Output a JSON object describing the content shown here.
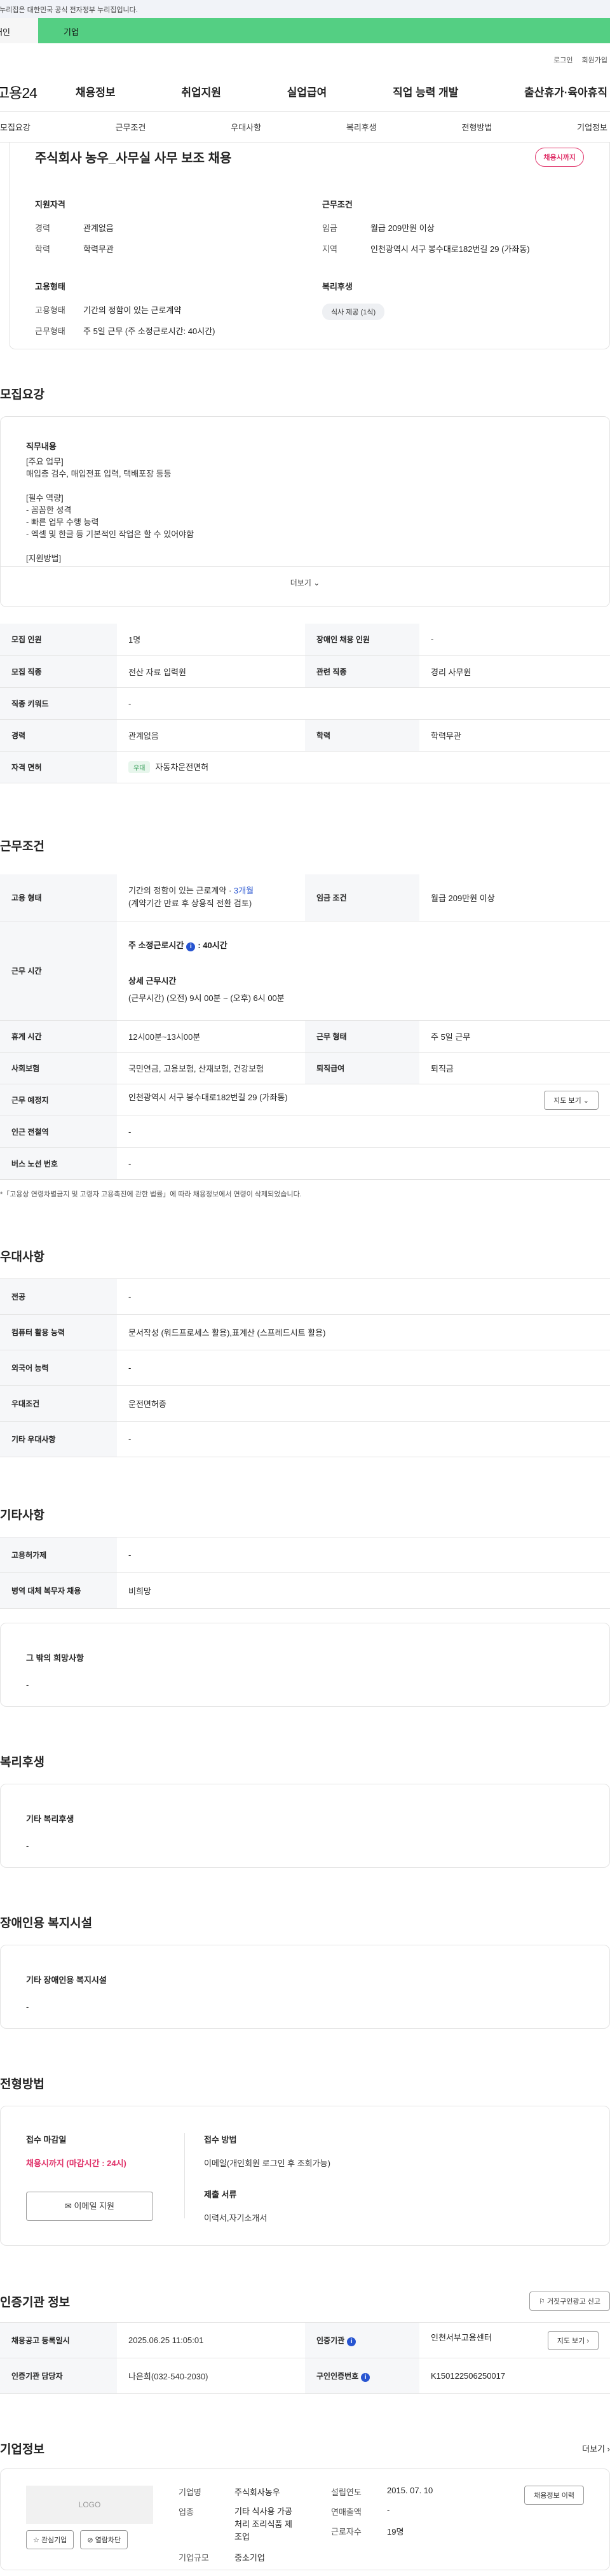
{
  "banner": "이 누리집은 대한민국 공식 전자정부 누리집입니다.",
  "top_tabs": [
    "개인",
    "기업"
  ],
  "util_links": [
    "로그인",
    "회원가입"
  ],
  "logo": "고용24",
  "gnb": [
    "채용정보",
    "취업지원",
    "실업급여",
    "직업 능력 개발",
    "출산휴가·육아휴직"
  ],
  "subnav": [
    "모집요강",
    "근무조건",
    "우대사항",
    "복리후생",
    "전형방법",
    "기업정보"
  ],
  "summary": {
    "title": "주식회사 농우_사무실 사무 보조 채용",
    "badge": "채용시까지",
    "qual_h": "지원자격",
    "career_k": "경력",
    "career_v": "관계없음",
    "edu_k": "학력",
    "edu_v": "학력무관",
    "cond_h": "근무조건",
    "wage_k": "임금",
    "wage_v": "월급 209만원 이상",
    "region_k": "지역",
    "region_v": "인천광역시 서구 봉수대로182번길 29 (가좌동)",
    "emp_h": "고용형태",
    "emptype_k": "고용형태",
    "emptype_v": "기간의 정함이 있는 근로계약",
    "worktype_k": "근무형태",
    "worktype_v": "주 5일 근무 (주 소정근로시간: 40시간)",
    "welfare_h": "복리후생",
    "welfare_chip": "식사 제공 (1식)"
  },
  "recruit": {
    "title": "모집요강",
    "desc_label": "직무내용",
    "desc_lines": [
      "[주요 업무]",
      "매입총 검수, 매입전표 입력, 택배포장 등등",
      "",
      "[필수 역량]",
      "- 꼼꼼한 성격",
      "- 빠른 업무 수행 능력",
      "- 엑셀 및 한글 등 기본적인 작업은 할 수 있어야함",
      "",
      "[지원방법]"
    ],
    "more": "더보기",
    "rows": [
      {
        "k1": "모집 인원",
        "v1": "1명",
        "k2": "장애인 채용 인원",
        "v2": "-"
      },
      {
        "k1": "모집 직종",
        "v1": "전산 자료 입력원",
        "k2": "관련 직종",
        "v2": "경리 사무원"
      },
      {
        "k1": "직종 키워드",
        "v1": "-"
      },
      {
        "k1": "경력",
        "v1": "관계없음",
        "k2": "학력",
        "v2": "학력무관"
      },
      {
        "k1": "자격 면허",
        "chip": "우대",
        "v1": "자동차운전면허"
      }
    ]
  },
  "work": {
    "title": "근무조건",
    "emp_k": "고용 형태",
    "emp_v1": "기간의 정함이 있는 근로계약 · ",
    "emp_v1b": "3개월",
    "emp_v2": "(계약기간 만료 후 상용직 전환 검토)",
    "wage_k": "임금 조건",
    "wage_v": "월급 209만원 이상",
    "hours_k": "근무 시간",
    "hours_l1": "주 소정근로시간",
    "hours_l1v": ": 40시간",
    "hours_l2": "상세 근무시간",
    "hours_l3": "(근무시간) (오전) 9시 00분 ~ (오후) 6시 00분",
    "break_k": "휴게 시간",
    "break_v": "12시00분~13시00분",
    "shift_k": "근무 형태",
    "shift_v": "주 5일 근무",
    "ins_k": "사회보험",
    "ins_v": "국민연금, 고용보험, 산재보험, 건강보험",
    "sev_k": "퇴직급여",
    "sev_v": "퇴직금",
    "loc_k": "근무 예정지",
    "loc_v": "인천광역시 서구 봉수대로182번길 29 (가좌동)",
    "map_btn": "지도 보기",
    "subway_k": "인근 전철역",
    "subway_v": "-",
    "bus_k": "버스 노선 번호",
    "bus_v": "-",
    "note": "*「고용상 연령차별금지 및 고령자 고용촉진에 관한 법률」에 따라 채용정보에서 연령이 삭제되었습니다."
  },
  "pref": {
    "title": "우대사항",
    "rows": [
      {
        "k": "전공",
        "v": "-"
      },
      {
        "k": "컴퓨터 활용 능력",
        "v": "문서작성 (워드프로세스 활용),표계산 (스프레드시트 활용)"
      },
      {
        "k": "외국어 능력",
        "v": "-"
      },
      {
        "k": "우대조건",
        "v": "운전면허증"
      },
      {
        "k": "기타 우대사항",
        "v": "-"
      }
    ]
  },
  "etc": {
    "title": "기타사항",
    "rows": [
      {
        "k": "고용허가제",
        "v": "-"
      },
      {
        "k": "병역 대체 복무자 채용",
        "v": "비희망"
      }
    ],
    "box_label": "그 밖의 희망사항",
    "box_value": "-"
  },
  "welfare": {
    "title": "복리후생",
    "label": "기타 복리후생",
    "value": "-"
  },
  "disabled": {
    "title": "장애인용 복지시설",
    "label": "기타 장애인용 복지시설",
    "value": "-"
  },
  "process": {
    "title": "전형방법",
    "deadline_label": "접수 마감일",
    "deadline_value": "채용시까지 (마감시간 : 24시)",
    "apply_btn": "이메일 지원",
    "method_label": "접수 방법",
    "method_value": "이메일(개인회원 로그인 후 조회가능)",
    "docs_label": "제출 서류",
    "docs_value": "이력서,자기소개서"
  },
  "agency": {
    "title": "인증기관 정보",
    "report_btn": "거짓구인광고 신고",
    "date_k": "채용공고 등록일시",
    "date_v": "2025.06.25 11:05:01",
    "org_k": "인증기관",
    "org_v": "인천서부고용센터",
    "map_btn": "지도 보기",
    "mgr_k": "인증기관 담당자",
    "mgr_v": "나은희(032-540-2030)",
    "no_k": "구인인증번호",
    "no_v": "K150122506250017"
  },
  "company": {
    "title": "기업정보",
    "more": "더보기",
    "logo_text": "LOGO",
    "fav_btn": "관심기업",
    "block_btn": "열람차단",
    "name_k": "기업명",
    "name_v": "주식회사농우",
    "ind_k": "업종",
    "ind_v1": "기타 식사용 가공",
    "ind_v2": "처리 조리식품 제",
    "ind_v3": "조업",
    "size_k": "기업규모",
    "size_v": "중소기업",
    "est_k": "설립연도",
    "est_v": "2015. 07. 10",
    "rev_k": "연매출액",
    "rev_v": "-",
    "emp_k": "근로자수",
    "emp_v": "19명",
    "history_btn": "채용정보 이력"
  }
}
